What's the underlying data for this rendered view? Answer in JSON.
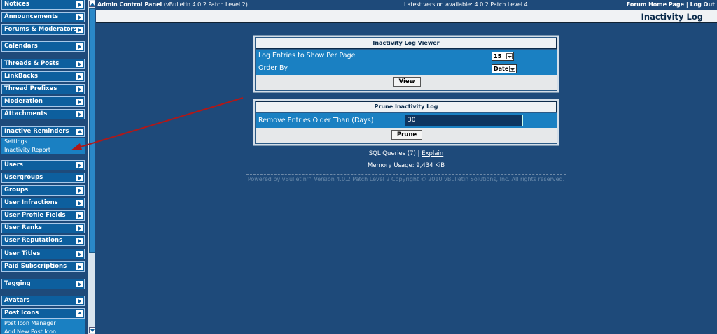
{
  "sidebar": {
    "groups": [
      {
        "label": "Notices",
        "expanded": false
      },
      {
        "label": "Announcements",
        "expanded": false
      },
      {
        "label": "Forums & Moderators",
        "expanded": false
      },
      {
        "label": "Calendars",
        "expanded": false
      },
      {
        "label": "Threads & Posts",
        "expanded": false
      },
      {
        "label": "LinkBacks",
        "expanded": false
      },
      {
        "label": "Thread Prefixes",
        "expanded": false
      },
      {
        "label": "Moderation",
        "expanded": false
      },
      {
        "label": "Attachments",
        "expanded": false
      },
      {
        "label": "Inactive Reminders",
        "expanded": true
      },
      {
        "label": "Users",
        "expanded": false
      },
      {
        "label": "Usergroups",
        "expanded": false
      },
      {
        "label": "Groups",
        "expanded": false
      },
      {
        "label": "User Infractions",
        "expanded": false
      },
      {
        "label": "User Profile Fields",
        "expanded": false
      },
      {
        "label": "User Ranks",
        "expanded": false
      },
      {
        "label": "User Reputations",
        "expanded": false
      },
      {
        "label": "User Titles",
        "expanded": false
      },
      {
        "label": "Paid Subscriptions",
        "expanded": false
      },
      {
        "label": "Tagging",
        "expanded": false
      },
      {
        "label": "Avatars",
        "expanded": false
      },
      {
        "label": "Post Icons",
        "expanded": true
      }
    ],
    "inactive_reminders_items": [
      "Settings",
      "Inactivity Report"
    ],
    "post_icons_items": [
      "Post Icon Manager",
      "Add New Post Icon"
    ]
  },
  "header": {
    "app_title": "Admin Control Panel",
    "version_note": "(vBulletin 4.0.2 Patch Level 2)",
    "latest_version": "Latest version available: 4.0.2 Patch Level 4",
    "forum_home_link": "Forum Home Page",
    "separator": "|",
    "logout_link": "Log Out",
    "page_title": "Inactivity Log"
  },
  "viewer_panel": {
    "title": "Inactivity Log Viewer",
    "entries_label": "Log Entries to Show Per Page",
    "entries_value": "15",
    "order_label": "Order By",
    "order_value": "Date",
    "view_button": "View"
  },
  "prune_panel": {
    "title": "Prune Inactivity Log",
    "older_label": "Remove Entries Older Than (Days)",
    "older_value": "30",
    "prune_button": "Prune"
  },
  "footer": {
    "sql_queries": "SQL Queries (7)",
    "sep": "|",
    "explain_link": "Explain",
    "memory": "Memory Usage: 9,434 KiB",
    "copyright": "Powered by vBulletin™ Version 4.0.2 Patch Level 2 Copyright © 2010 vBulletin Solutions, Inc. All rights reserved."
  },
  "colors": {
    "page_background": "#1e4a7a",
    "nav_header": "#0d5f9e",
    "row_blue": "#1a80c2",
    "annotation_arrow": "#b01818"
  }
}
